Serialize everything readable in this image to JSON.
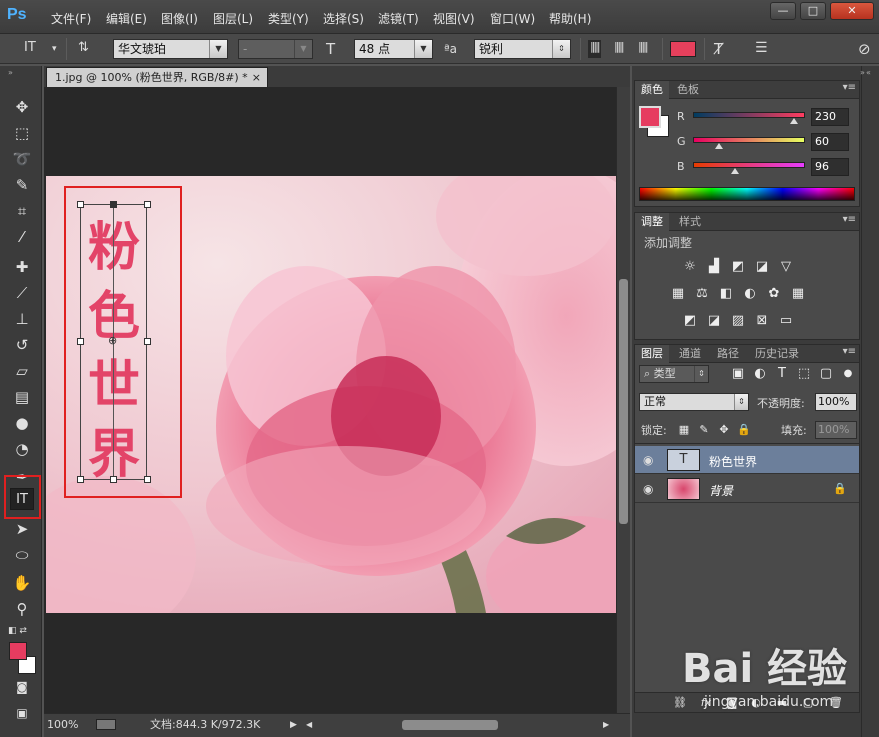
{
  "app": {
    "logo": "Ps"
  },
  "menu": [
    "文件(F)",
    "编辑(E)",
    "图像(I)",
    "图层(L)",
    "类型(Y)",
    "选择(S)",
    "滤镜(T)",
    "视图(V)",
    "窗口(W)",
    "帮助(H)"
  ],
  "window_buttons": {
    "minimize": "—",
    "maximize": "□",
    "close": "✕"
  },
  "options": {
    "tool_icon": "IT",
    "font_family": "华文琥珀",
    "font_style": "-",
    "font_size": "48 点",
    "aa_label": "ªa",
    "antialias": "锐利",
    "text_color": "#e6405c"
  },
  "document": {
    "tab_title": "1.jpg @ 100% (粉色世界, RGB/8#) *",
    "tab_close": "×",
    "text_chars": [
      "粉",
      "色",
      "世",
      "界"
    ]
  },
  "status": {
    "zoom": "100%",
    "doc_info": "文档:844.3 K/972.3K"
  },
  "color_panel": {
    "tabs": [
      "颜色",
      "色板"
    ],
    "fg_color": "#e63c60",
    "bg_color": "#ffffff",
    "channels": [
      {
        "label": "R",
        "value": "230",
        "level": 0.902
      },
      {
        "label": "G",
        "value": "60",
        "level": 0.235
      },
      {
        "label": "B",
        "value": "96",
        "level": 0.376
      }
    ]
  },
  "adjust_panel": {
    "tabs": [
      "调整",
      "样式"
    ],
    "title": "添加调整",
    "icons": [
      "brightness-icon",
      "levels-icon",
      "curves-icon",
      "exposure-icon",
      "vibrance-icon",
      "hue-saturation-icon",
      "color-balance-icon",
      "black-white-icon",
      "photo-filter-icon",
      "channel-mixer-icon",
      "color-lookup-icon",
      "invert-icon",
      "posterize-icon",
      "threshold-icon",
      "selective-color-icon",
      "gradient-map-icon"
    ]
  },
  "layers_panel": {
    "tabs": [
      "图层",
      "通道",
      "路径",
      "历史记录"
    ],
    "filter_label": "类型",
    "blend_mode": "正常",
    "opacity_label": "不透明度:",
    "opacity_value": "100%",
    "lock_label": "锁定:",
    "fill_label": "填充:",
    "fill_value": "100%",
    "layers": [
      {
        "name": "粉色世界",
        "type": "text",
        "selected": true,
        "thumb_label": "T"
      },
      {
        "name": "背景",
        "type": "image",
        "selected": false,
        "locked": true
      }
    ]
  },
  "watermark": {
    "brand": "Bai 经验",
    "url": "jingyan.baidu.com"
  }
}
